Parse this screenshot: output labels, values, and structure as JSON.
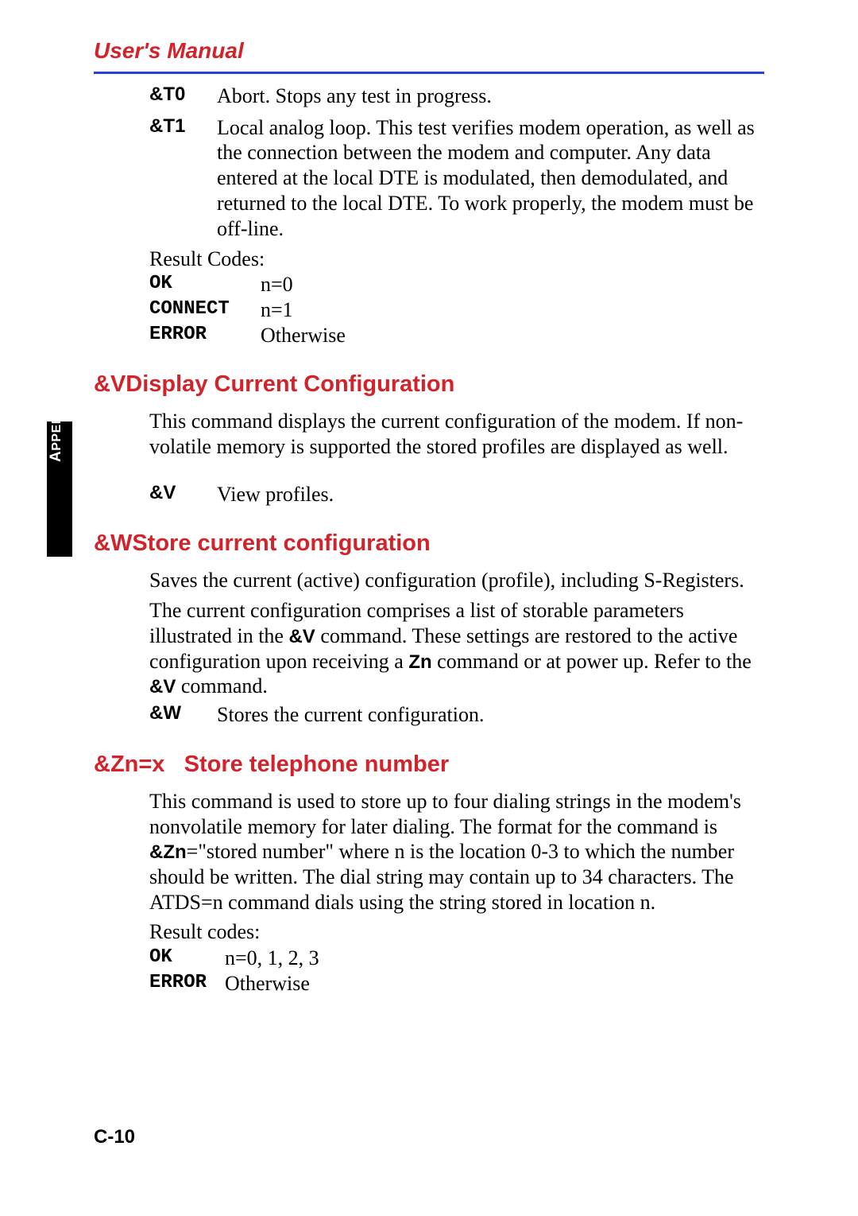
{
  "header": {
    "title": "User's Manual"
  },
  "sidebar_tab": "APPENDIX C",
  "t_section": {
    "items": [
      {
        "cmd": "&T0",
        "desc": "Abort. Stops any test in progress."
      },
      {
        "cmd": "&T1",
        "desc": "Local analog loop. This test verifies modem operation, as well as the connection between the modem and computer. Any data entered at the local DTE is modulated, then demodulated, and returned to the local DTE. To work properly, the modem must be off-line."
      }
    ],
    "result_label": "Result Codes:",
    "result_codes": [
      {
        "code": "OK",
        "value": "n=0"
      },
      {
        "code": "CONNECT",
        "value": "n=1"
      },
      {
        "code": "ERROR",
        "value": "Otherwise"
      }
    ]
  },
  "v_section": {
    "heading": "&VDisplay Current Configuration",
    "para": "This command displays the current configuration of the modem. If non-volatile memory is supported the stored profiles are displayed as well.",
    "item": {
      "cmd": "&V",
      "desc": "View profiles."
    }
  },
  "w_section": {
    "heading": "&WStore current configuration",
    "para1": "Saves the current (active) configuration (profile), including S-Registers.",
    "para2_pre": "The current configuration comprises a list of storable parameters illustrated in the ",
    "para2_b1": "&V",
    "para2_mid1": " command. These settings are restored to the active configuration upon receiving a ",
    "para2_b2": "Zn",
    "para2_mid2": " command or at power up. Refer to the ",
    "para2_b3": "&V",
    "para2_end": " command.",
    "item": {
      "cmd": "&W",
      "desc": "Stores the current configuration."
    }
  },
  "z_section": {
    "heading": "&Zn=x   Store telephone number",
    "para_pre": "This command is used to store up to four dialing strings in the modem's nonvolatile memory for later dialing. The format for the command is ",
    "para_b": "&Zn",
    "para_post": "=\"stored number\" where n is the location 0-3 to which the number should be written. The dial string may contain up to 34 characters. The ATDS=n command dials using the string stored in location n.",
    "result_label": "Result codes:",
    "result_codes": [
      {
        "code": "OK",
        "value": "n=0, 1, 2, 3"
      },
      {
        "code": "ERROR",
        "value": "Otherwise"
      }
    ]
  },
  "page_number": "C-10"
}
